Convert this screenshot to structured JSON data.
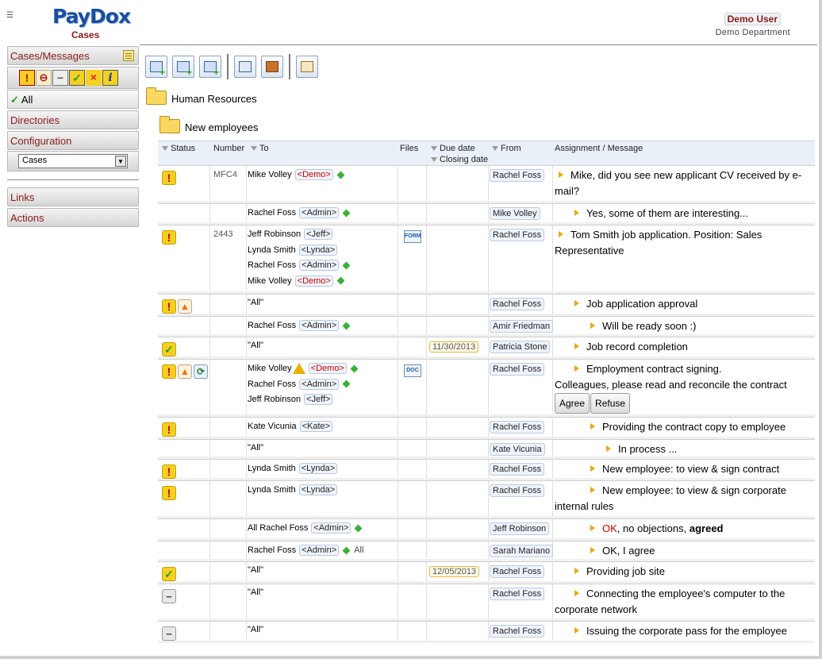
{
  "header": {
    "menu_icon": "☰",
    "logo": "PayDox",
    "section": "Cases",
    "user_name": "Demo User",
    "user_department": "Demo Department"
  },
  "sidebar": {
    "cases_messages": "Cases/Messages",
    "status_filters": [
      {
        "icon": "urgent-icon",
        "glyph": "!"
      },
      {
        "icon": "stop-icon",
        "glyph": "⊖"
      },
      {
        "icon": "minus-icon",
        "glyph": "−"
      },
      {
        "icon": "check-icon",
        "glyph": "✓"
      },
      {
        "icon": "x-icon",
        "glyph": "×"
      },
      {
        "icon": "info-icon",
        "glyph": "i"
      }
    ],
    "all_label": "All",
    "directories": "Directories",
    "configuration": "Configuration",
    "select_value": "Cases",
    "links": "Links",
    "actions": "Actions"
  },
  "toolbar": {
    "buttons": [
      "new-message-icon",
      "new-case-icon",
      "new-subcase-icon",
      "calendar-icon",
      "briefcase-icon",
      "report-icon"
    ]
  },
  "folders": {
    "parent": "Human Resources",
    "child": "New employees"
  },
  "table": {
    "headers": {
      "status": "Status",
      "number": "Number",
      "to": "To",
      "files": "Files",
      "due_date": "Due date",
      "closing_date": "Closing date",
      "from": "From",
      "message": "Assignment / Message"
    },
    "rows": [
      {
        "status": [
          "urgent"
        ],
        "number": "MFC4",
        "to": [
          {
            "name": "Mike Volley",
            "tag": "<Demo>",
            "red": true,
            "dia": true
          }
        ],
        "from": "Rachel Foss",
        "indent": 0,
        "msg": "Mike, did you see new applicant CV received by e-mail?"
      },
      {
        "status": [],
        "number": "",
        "to": [
          {
            "name": "Rachel Foss",
            "tag": "<Admin>",
            "dia": true
          }
        ],
        "from": "Mike Volley",
        "indent": 1,
        "msg": "Yes, some of them are interesting..."
      },
      {
        "status": [
          "urgent"
        ],
        "number": "2443",
        "to": [
          {
            "name": "Jeff Robinson",
            "tag": "<Jeff>"
          },
          {
            "name": "Lynda Smith",
            "tag": "<Lynda>"
          },
          {
            "name": "Rachel Foss",
            "tag": "<Admin>",
            "dia": true
          },
          {
            "name": "Mike Volley",
            "tag": "<Demo>",
            "red": true,
            "dia": true
          }
        ],
        "file": "FORM",
        "from": "Rachel Foss",
        "indent": 0,
        "msg": "Tom Smith job application. Position: Sales Representative"
      },
      {
        "status": [
          "urgent",
          "cone"
        ],
        "number": "",
        "to": [
          {
            "name": "\"All\""
          }
        ],
        "from": "Rachel Foss",
        "indent": 1,
        "msg": "Job application approval"
      },
      {
        "status": [],
        "number": "",
        "to": [
          {
            "name": "Rachel Foss",
            "tag": "<Admin>",
            "dia": true
          }
        ],
        "from": "Amir Friedman",
        "indent": 2,
        "msg": "Will be ready soon :)"
      },
      {
        "status": [
          "check"
        ],
        "number": "",
        "to": [
          {
            "name": "\"All\""
          }
        ],
        "date": "11/30/2013",
        "from": "Patricia Stone",
        "indent": 1,
        "msg": "Job record completion"
      },
      {
        "status": [
          "urgent",
          "cone",
          "loop"
        ],
        "number": "",
        "to": [
          {
            "name": "Mike Volley",
            "warn": true,
            "tag": "<Demo>",
            "red": true,
            "dia": true
          },
          {
            "name": "Rachel Foss",
            "tag": "<Admin>",
            "dia": true
          },
          {
            "name": "Jeff Robinson",
            "tag": "<Jeff>"
          }
        ],
        "file": "DOC",
        "from": "Rachel Foss",
        "indent": 1,
        "msg": "Employment contract signing.",
        "msg2": "Colleagues, please read and reconcile the contract",
        "buttons": [
          "Agree",
          "Refuse"
        ]
      },
      {
        "status": [
          "urgent"
        ],
        "number": "",
        "to": [
          {
            "name": "Kate Vicunia",
            "tag": "<Kate>"
          }
        ],
        "from": "Rachel Foss",
        "indent": 2,
        "msg": "Providing the contract copy to employee"
      },
      {
        "status": [],
        "number": "",
        "to": [
          {
            "name": "\"All\""
          }
        ],
        "from": "Kate Vicunia",
        "indent": 3,
        "msg": "In process ..."
      },
      {
        "status": [
          "urgent"
        ],
        "number": "",
        "to": [
          {
            "name": "Lynda Smith",
            "tag": "<Lynda>"
          }
        ],
        "from": "Rachel Foss",
        "indent": 2,
        "msg": "New employee: to view & sign contract"
      },
      {
        "status": [
          "urgent"
        ],
        "number": "",
        "to": [
          {
            "name": "Lynda Smith",
            "tag": "<Lynda>"
          }
        ],
        "from": "Rachel Foss",
        "indent": 2,
        "msg": "New employee: to view & sign corporate internal rules"
      },
      {
        "status": [],
        "number": "",
        "to": [
          {
            "name": "All Rachel Foss",
            "tag": "<Admin>",
            "dia": true
          }
        ],
        "from": "Jeff Robinson",
        "indent": 2,
        "msg_ok": "OK",
        "msg": ", no objections, ",
        "msg_bold": "agreed"
      },
      {
        "status": [],
        "number": "",
        "to": [
          {
            "name": "Rachel Foss",
            "tag": "<Admin>",
            "dia": true,
            "suffix": "All"
          }
        ],
        "from": "Sarah Mariano",
        "indent": 2,
        "msg": "OK, I agree"
      },
      {
        "status": [
          "check"
        ],
        "number": "",
        "to": [
          {
            "name": "\"All\""
          }
        ],
        "date": "12/05/2013",
        "from": "Rachel Foss",
        "indent": 1,
        "msg": "Providing job site"
      },
      {
        "status": [
          "minus"
        ],
        "number": "",
        "to": [
          {
            "name": "\"All\""
          }
        ],
        "from": "Rachel Foss",
        "indent": 1,
        "msg": "Connecting the employee's computer to the corporate network"
      },
      {
        "status": [
          "minus"
        ],
        "number": "",
        "to": [
          {
            "name": "\"All\""
          }
        ],
        "from": "Rachel Foss",
        "indent": 1,
        "msg": "Issuing the corporate pass for the employee"
      }
    ]
  }
}
